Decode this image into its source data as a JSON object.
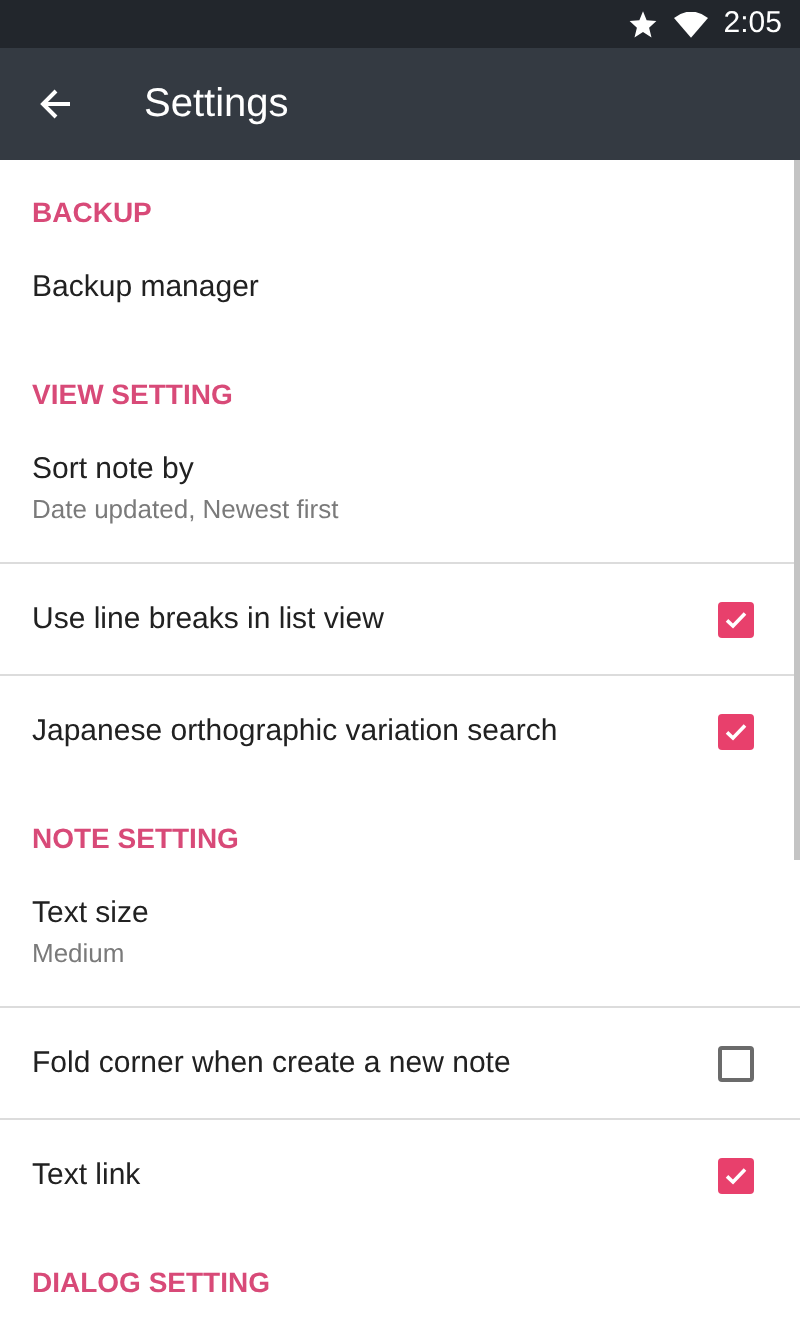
{
  "status_bar": {
    "time": "2:05"
  },
  "app_bar": {
    "title": "Settings"
  },
  "sections": [
    {
      "header": "BACKUP",
      "items": [
        {
          "kind": "nav",
          "title": "Backup manager"
        }
      ]
    },
    {
      "header": "VIEW SETTING",
      "items": [
        {
          "kind": "nav",
          "title": "Sort note by",
          "subtitle": "Date updated, Newest first"
        },
        {
          "kind": "checkbox",
          "title": "Use line breaks in list view",
          "checked": true
        },
        {
          "kind": "checkbox",
          "title": "Japanese orthographic variation search",
          "checked": true
        }
      ]
    },
    {
      "header": "NOTE SETTING",
      "items": [
        {
          "kind": "nav",
          "title": "Text size",
          "subtitle": "Medium"
        },
        {
          "kind": "checkbox",
          "title": "Fold corner when create a new note",
          "checked": false
        },
        {
          "kind": "checkbox",
          "title": "Text link",
          "checked": true
        }
      ]
    },
    {
      "header": "DIALOG SETTING"
    }
  ]
}
